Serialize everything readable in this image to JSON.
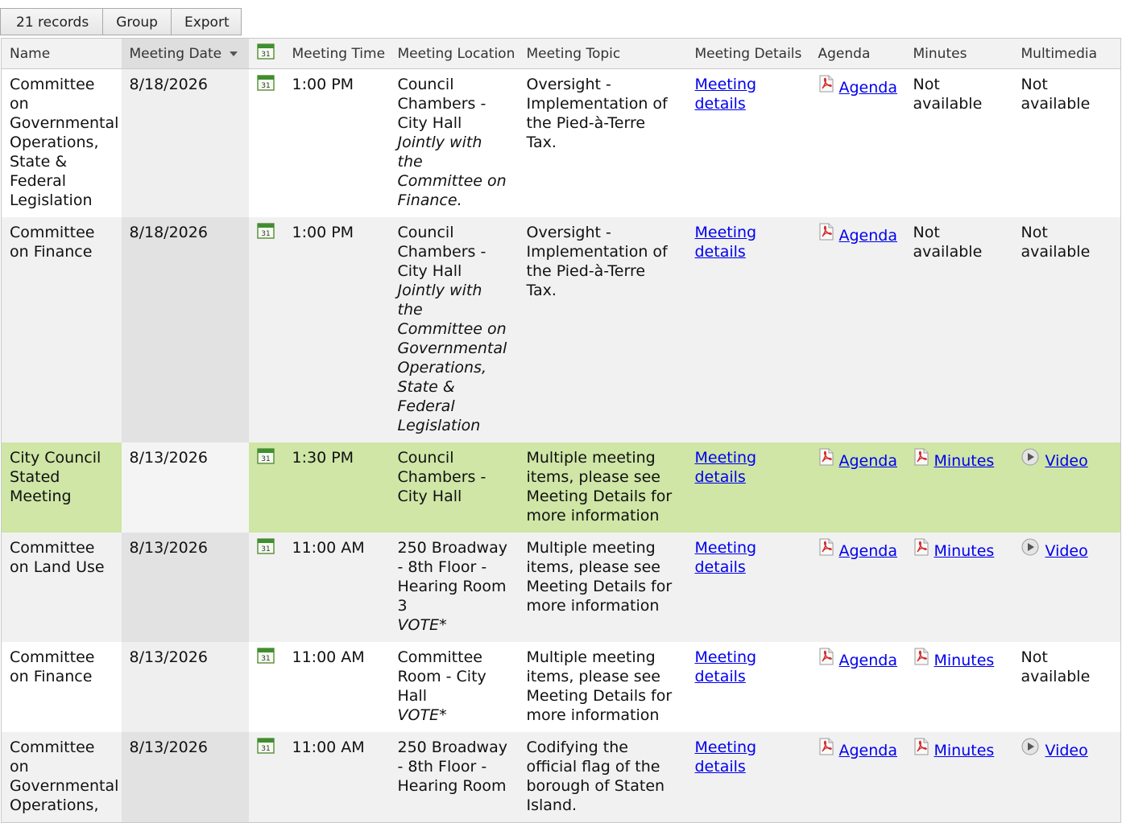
{
  "toolbar": {
    "records": "21 records",
    "group": "Group",
    "export": "Export"
  },
  "columns": {
    "name": "Name",
    "date": "Meeting Date",
    "time": "Meeting Time",
    "location": "Meeting Location",
    "topic": "Meeting Topic",
    "details": "Meeting Details",
    "agenda": "Agenda",
    "minutes": "Minutes",
    "multimedia": "Multimedia"
  },
  "icons": {
    "calendar": "calendar-icon",
    "pdf": "pdf-icon",
    "video": "video-play-icon"
  },
  "calendar_day": "31",
  "colors": {
    "highlight_row": "#cfe6a6",
    "link": "#0000ee",
    "sorted_header": "#dedede"
  },
  "rows": [
    {
      "name": "Committee on Governmental Operations, State & Federal Legislation",
      "date": "8/18/2026",
      "time": "1:00 PM",
      "location": "Council Chambers - City Hall",
      "location_note": "Jointly with the Committee on Finance.",
      "topic": "Oversight - Implementation of the Pied-à-Terre Tax.",
      "details": "Meeting details",
      "agenda": "Agenda",
      "minutes": "Not available",
      "multimedia": "Not available"
    },
    {
      "name": "Committee on Finance",
      "date": "8/18/2026",
      "time": "1:00 PM",
      "location": "Council Chambers - City Hall",
      "location_note": "Jointly with the Committee on Governmental Operations, State & Federal Legislation",
      "topic": "Oversight - Implementation of the Pied-à-Terre Tax.",
      "details": "Meeting details",
      "agenda": "Agenda",
      "minutes": "Not available",
      "multimedia": "Not available"
    },
    {
      "name": "City Council Stated Meeting",
      "date": "8/13/2026",
      "time": "1:30 PM",
      "location": "Council Chambers - City Hall",
      "location_note": "",
      "topic": "Multiple meeting items, please see Meeting Details for more information",
      "details": "Meeting details",
      "agenda": "Agenda",
      "minutes": "Minutes",
      "multimedia": "Video"
    },
    {
      "name": "Committee on Land Use",
      "date": "8/13/2026",
      "time": "11:00 AM",
      "location": "250 Broadway - 8th Floor - Hearing Room 3",
      "location_note": "VOTE*",
      "topic": "Multiple meeting items, please see Meeting Details for more information",
      "details": "Meeting details",
      "agenda": "Agenda",
      "minutes": "Minutes",
      "multimedia": "Video"
    },
    {
      "name": "Committee on Finance",
      "date": "8/13/2026",
      "time": "11:00 AM",
      "location": "Committee Room - City Hall",
      "location_note": "VOTE*",
      "topic": "Multiple meeting items, please see Meeting Details for more information",
      "details": "Meeting details",
      "agenda": "Agenda",
      "minutes": "Minutes",
      "multimedia": "Not available"
    },
    {
      "name": "Committee on Governmental Operations,",
      "date": "8/13/2026",
      "time": "11:00 AM",
      "location": "250 Broadway - 8th Floor - Hearing Room",
      "location_note": "",
      "topic": "Codifying the official flag of the borough of Staten Island.",
      "details": "Meeting details",
      "agenda": "Agenda",
      "minutes": "Minutes",
      "multimedia": "Video"
    }
  ]
}
